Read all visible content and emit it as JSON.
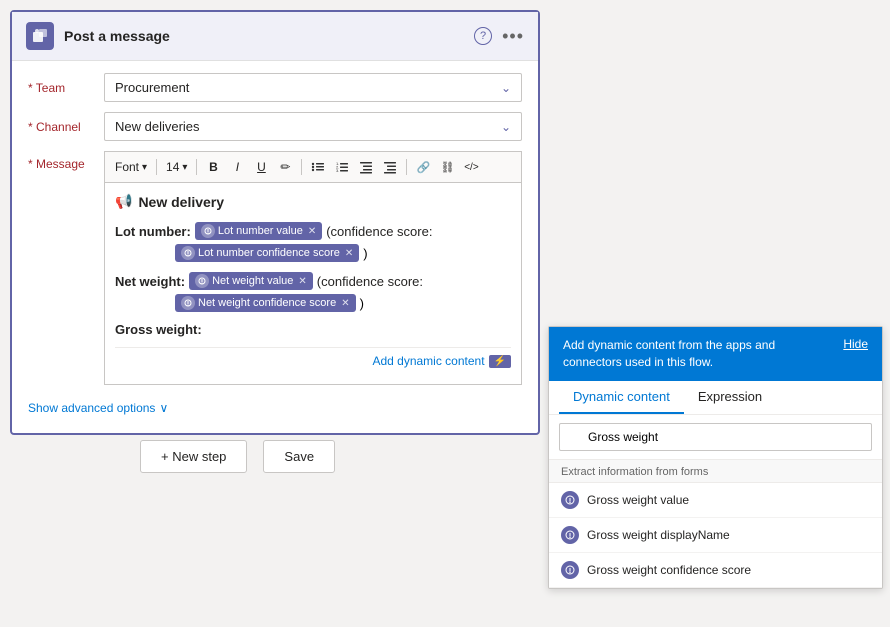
{
  "header": {
    "title": "Post a message",
    "teams_icon": "T",
    "help_icon": "?",
    "more_icon": "..."
  },
  "fields": {
    "team_label": "Team",
    "team_value": "Procurement",
    "channel_label": "Channel",
    "channel_value": "New deliveries",
    "message_label": "Message"
  },
  "toolbar": {
    "font_label": "Font",
    "size_label": "14",
    "bold": "B",
    "italic": "I",
    "underline": "U",
    "pencil": "✏",
    "list_ul": "≡",
    "list_ol": "≡",
    "indent_less": "⇤",
    "indent_more": "⇥",
    "link": "🔗",
    "unlink": "⛓",
    "code": "</>",
    "arrow_down": "▾"
  },
  "message": {
    "heading_icon": "📢",
    "heading_text": "New delivery",
    "lot_number_label": "Lot number:",
    "lot_number_tag": "Lot number value",
    "confidence_score_text": "(confidence score:",
    "lot_confidence_tag": "Lot number confidence score",
    "close_bracket": ")",
    "net_weight_label": "Net weight:",
    "net_weight_tag": "Net weight value",
    "net_confidence_tag": "Net weight confidence score",
    "gross_weight_label": "Gross weight:"
  },
  "add_dynamic": {
    "link_text": "Add dynamic content"
  },
  "advanced": {
    "label": "Show advanced options",
    "arrow": "∨"
  },
  "bottom_buttons": {
    "new_step_icon": "+",
    "new_step_label": "New step",
    "save_label": "Save"
  },
  "dynamic_panel": {
    "header_text": "Add dynamic content from the apps and connectors used in this flow.",
    "hide_label": "Hide",
    "tab_dynamic": "Dynamic content",
    "tab_expression": "Expression",
    "search_placeholder": "Gross weight",
    "section_label": "Extract information from forms",
    "items": [
      {
        "label": "Gross weight value"
      },
      {
        "label": "Gross weight displayName"
      },
      {
        "label": "Gross weight confidence score"
      }
    ]
  }
}
